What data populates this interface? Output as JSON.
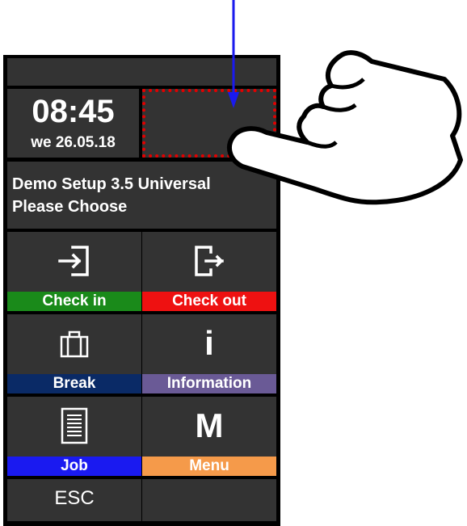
{
  "clock": {
    "time": "08:45",
    "date": "we 26.05.18"
  },
  "message": {
    "line1": "Demo Setup 3.5 Universal",
    "line2": "Please Choose"
  },
  "tiles": [
    {
      "label": "Check in",
      "color": "#1a8a1a",
      "icon": "check-in-icon"
    },
    {
      "label": "Check out",
      "color": "#ee1111",
      "icon": "check-out-icon"
    },
    {
      "label": "Break",
      "color": "#0a2a66",
      "icon": "briefcase-icon"
    },
    {
      "label": "Information",
      "color": "#6a5a96",
      "icon": "info-icon",
      "glyph": "i"
    },
    {
      "label": "Job",
      "color": "#1a1af0",
      "icon": "document-icon"
    },
    {
      "label": "Menu",
      "color": "#f59a4a",
      "icon": "menu-icon",
      "glyph": "M"
    }
  ],
  "esc": {
    "label": "ESC"
  },
  "colors": {
    "panel": "#333333",
    "frame": "#000000",
    "highlight": "#e30000",
    "pointer": "#1a1aee"
  }
}
